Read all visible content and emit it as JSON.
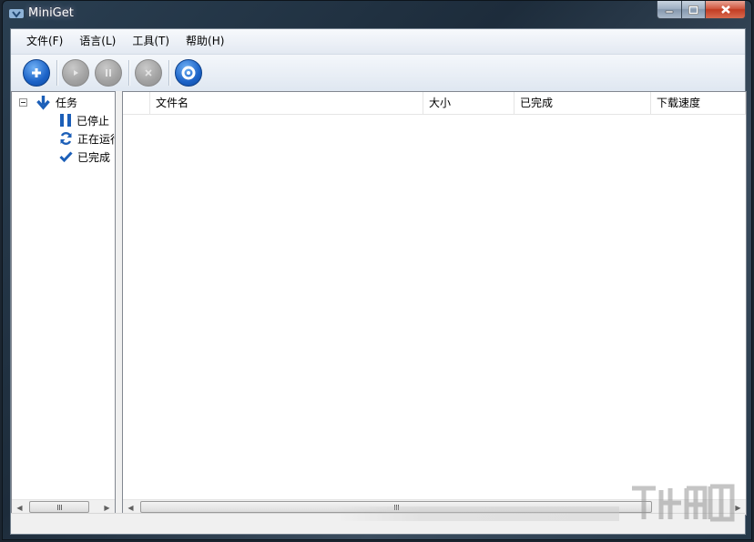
{
  "window": {
    "title": "MiniGet"
  },
  "menu": [
    {
      "label": "文件(F)"
    },
    {
      "label": "语言(L)"
    },
    {
      "label": "工具(T)"
    },
    {
      "label": "帮助(H)"
    }
  ],
  "toolbar": {
    "buttons": [
      {
        "icon": "add-icon",
        "enabled": true
      },
      {
        "icon": "play-icon",
        "enabled": false
      },
      {
        "icon": "pause-icon",
        "enabled": false
      },
      {
        "icon": "stop-icon",
        "enabled": false
      },
      {
        "icon": "settings-icon",
        "enabled": true
      }
    ]
  },
  "tree": {
    "root": {
      "label": "任务",
      "icon": "download-arrow-icon"
    },
    "children": [
      {
        "label": "已停止",
        "icon": "pause-icon"
      },
      {
        "label": "正在运行",
        "icon": "refresh-icon"
      },
      {
        "label": "已完成",
        "icon": "checkmark-icon"
      }
    ]
  },
  "list": {
    "columns": [
      "",
      "文件名",
      "大小",
      "已完成",
      "下载速度"
    ]
  },
  "scrollbar": {
    "grip": "III"
  },
  "status": {
    "text": ""
  },
  "colors": {
    "accent": "#1b62c7",
    "icon_blue": "#1c5fb8"
  }
}
